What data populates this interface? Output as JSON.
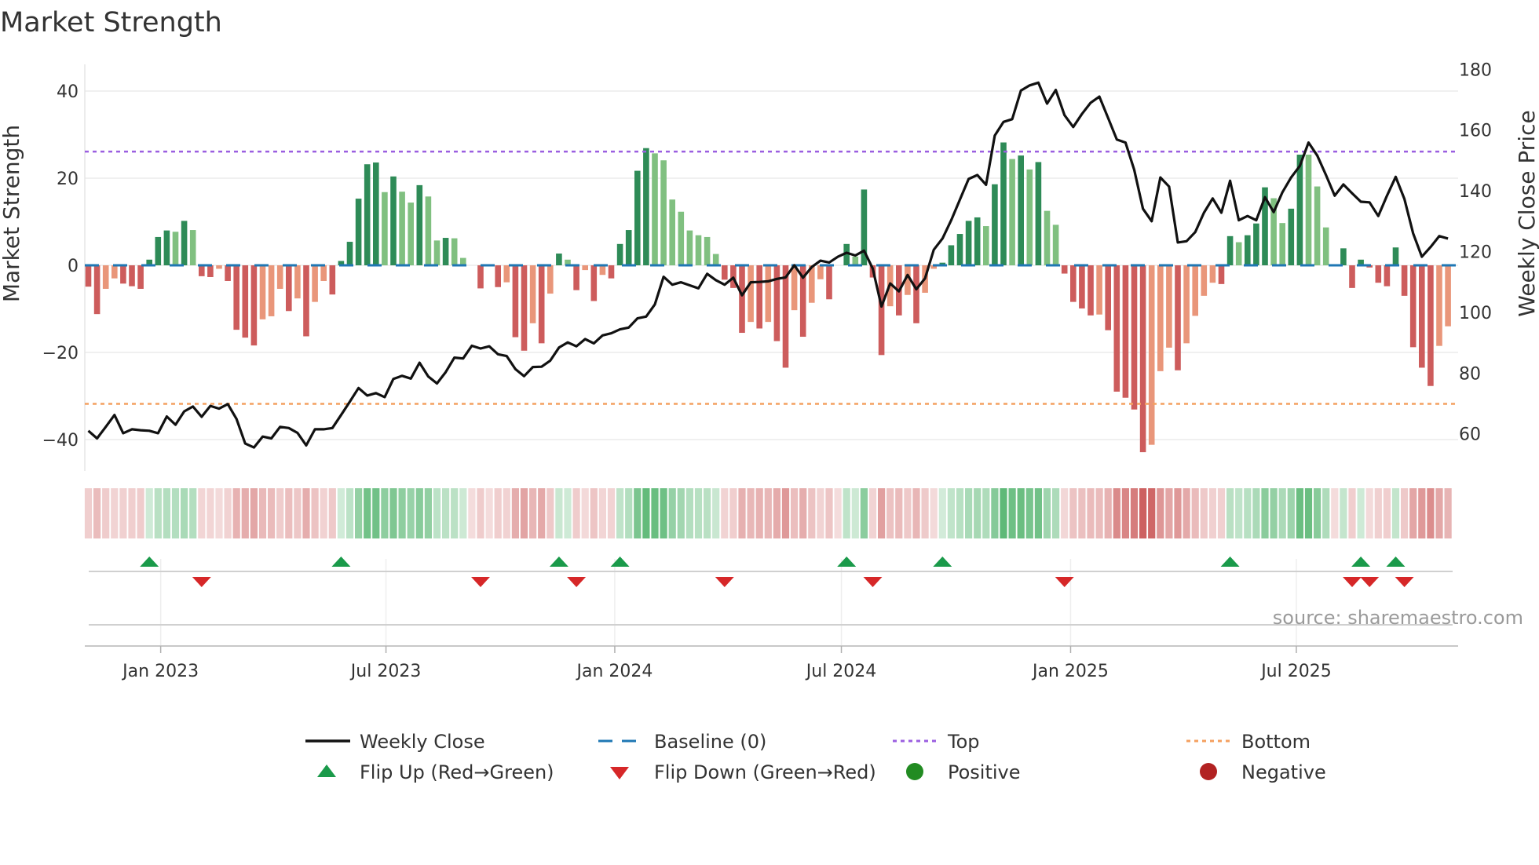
{
  "chart_data": {
    "type": "bar",
    "title": "Market Strength",
    "ylabel": "Market Strength",
    "y2label": "Weekly Close Price",
    "ylim": [
      -47,
      46
    ],
    "y2lim": [
      52,
      182
    ],
    "yticks": [
      {
        "value": 40,
        "label": "40"
      },
      {
        "value": 20,
        "label": "20"
      },
      {
        "value": 0,
        "label": "0"
      },
      {
        "value": -20,
        "label": "−20"
      },
      {
        "value": -40,
        "label": "−40"
      }
    ],
    "y2ticks": [
      {
        "value": 180,
        "label": "180"
      },
      {
        "value": 160,
        "label": "160"
      },
      {
        "value": 140,
        "label": "140"
      },
      {
        "value": 120,
        "label": "120"
      },
      {
        "value": 100,
        "label": "100"
      },
      {
        "value": 80,
        "label": "80"
      },
      {
        "value": 60,
        "label": "60"
      }
    ],
    "xticks": [
      {
        "week": 8.3,
        "label": "Jan 2023"
      },
      {
        "week": 34.15,
        "label": "Jul 2023"
      },
      {
        "week": 60.4,
        "label": "Jan 2024"
      },
      {
        "week": 86.4,
        "label": "Jul 2024"
      },
      {
        "week": 112.7,
        "label": "Jan 2025"
      },
      {
        "week": 138.6,
        "label": "Jul 2025"
      }
    ],
    "top_level": 26.1,
    "bottom_level": -31.8,
    "grid": true,
    "legend_placement": "bottom",
    "strength": [
      -4.9,
      -11.2,
      -5.4,
      -3,
      -4.2,
      -4.8,
      -5.4,
      1.3,
      6.5,
      8,
      7.7,
      10.2,
      8.1,
      -2.5,
      -2.7,
      -0.8,
      -3.6,
      -14.8,
      -16.6,
      -18.4,
      -12.4,
      -11.7,
      -5.4,
      -10.5,
      -7.6,
      -16.3,
      -8.4,
      -3.6,
      -6.7,
      1,
      5.4,
      15.3,
      23.2,
      23.6,
      16.8,
      20.4,
      16.9,
      14.4,
      18.4,
      15.8,
      5.7,
      6.3,
      6.2,
      1.7,
      0,
      -5.3,
      0,
      -5,
      -3.9,
      -16.5,
      -19.6,
      -13.3,
      -17.9,
      -6.5,
      2.7,
      1.3,
      -5.7,
      -1.1,
      -8.2,
      -2.2,
      -3,
      4.9,
      8.1,
      21.7,
      26.9,
      25.7,
      24.1,
      15.1,
      12.3,
      8,
      6.9,
      6.5,
      2.6,
      -3.3,
      -5.2,
      -15.5,
      -13,
      -14.5,
      -13,
      -17.4,
      -23.5,
      -10.3,
      -16.4,
      -8.6,
      -3.2,
      -7.8,
      0,
      4.9,
      2,
      17.4,
      -2.8,
      -20.6,
      -9.4,
      -11.5,
      -6.8,
      -13.3,
      -6.3,
      -0.8,
      0.6,
      4.6,
      7.2,
      10.2,
      11,
      9,
      18.6,
      28.2,
      24.4,
      25.2,
      22,
      23.7,
      12.5,
      9.3,
      -1.9,
      -8.4,
      -9.9,
      -11.5,
      -11.3,
      -14.9,
      -29,
      -30.4,
      -33.1,
      -42.9,
      -41.2,
      -24.3,
      -18.9,
      -24.1,
      -17.9,
      -11.6,
      -7,
      -4,
      -4.3,
      6.7,
      5.3,
      6.9,
      9.6,
      17.9,
      15.4,
      9.7,
      13,
      25.4,
      25.4,
      18.1,
      8.7,
      0,
      3.9,
      -5.2,
      1.3,
      -0.5,
      -4,
      -4.8,
      4.1,
      -7,
      -18.8,
      -23.5,
      -27.7,
      -18.5,
      -14
    ],
    "weekly_close": [
      61,
      58.5,
      62.3,
      66.2,
      60.2,
      61.5,
      61.2,
      61,
      60.2,
      65.7,
      63,
      67.4,
      69,
      65.6,
      69.2,
      68.3,
      69.8,
      64.9,
      56.8,
      55.5,
      59.1,
      58.5,
      62.3,
      61.9,
      60.3,
      56.2,
      61.5,
      61.5,
      61.9,
      66.2,
      70.6,
      75.1,
      72.6,
      73.4,
      72.1,
      78.1,
      79.1,
      78.2,
      83.4,
      78.9,
      76.6,
      80.3,
      85.1,
      84.8,
      89,
      88.1,
      88.8,
      86.2,
      85.6,
      81.3,
      79,
      82,
      82.1,
      84.1,
      88.4,
      90.1,
      88.8,
      91.2,
      89.8,
      92.4,
      93.1,
      94.4,
      95,
      98,
      98.6,
      102.6,
      111.7,
      109.1,
      109.9,
      108.9,
      107.9,
      112.7,
      110.6,
      109.1,
      111.4,
      105.6,
      109.9,
      110,
      110.2,
      111,
      111.5,
      115.5,
      111.4,
      114.9,
      117,
      116.4,
      118.3,
      119.6,
      118.7,
      120.3,
      114.4,
      101.9,
      109.5,
      106.9,
      112.3,
      107.6,
      111.2,
      120.6,
      124.3,
      130.3,
      137.1,
      143.9,
      145.2,
      142,
      158.2,
      162.7,
      163.6,
      173,
      174.7,
      175.6,
      168.7,
      173.2,
      164.9,
      161,
      165.3,
      169,
      171,
      164,
      156.9,
      155.9,
      146.9,
      134.1,
      130,
      144.4,
      141.4,
      123,
      123.4,
      126.4,
      132.8,
      137.5,
      132.8,
      143.3,
      130.3,
      131.7,
      130.3,
      137.9,
      133,
      139.5,
      144.4,
      148.2,
      155.9,
      151.6,
      145.2,
      138.4,
      142.1,
      139.2,
      136.4,
      136.2,
      131.7,
      138.4,
      144.6,
      137.3,
      126,
      118.3,
      121.5,
      125.1,
      124.3
    ],
    "flip_up_weeks": [
      7,
      29,
      54,
      61,
      87,
      98,
      131,
      146,
      150
    ],
    "flip_down_weeks": [
      13,
      45,
      56,
      73,
      90,
      112,
      145,
      147,
      151
    ],
    "source": "source: sharemaestro.com",
    "legend": [
      {
        "label": "Weekly Close",
        "icon": "solid-line"
      },
      {
        "label": "Baseline (0)",
        "icon": "dashed-line"
      },
      {
        "label": "Top",
        "icon": "dotted-line"
      },
      {
        "label": "Bottom",
        "icon": "dotted-line"
      },
      {
        "label": "Flip Up (Red→Green)",
        "icon": "triangle-up"
      },
      {
        "label": "Flip Down (Green→Red)",
        "icon": "triangle-down"
      },
      {
        "label": "Positive",
        "icon": "circle"
      },
      {
        "label": "Negative",
        "icon": "circle"
      }
    ],
    "colors": {
      "pos_strong": "#2e8b57",
      "pos_weak": "#80c080",
      "neg_strong": "#cd5c5c",
      "neg_weak": "#e9967a",
      "price": "#111111",
      "baseline": "#1f77b4",
      "top": "#9b5fe0",
      "bottom": "#f4a060",
      "flip_up": "#1a9a4a",
      "flip_down": "#d62728",
      "positive": "#228b22",
      "negative": "#b22222"
    }
  }
}
